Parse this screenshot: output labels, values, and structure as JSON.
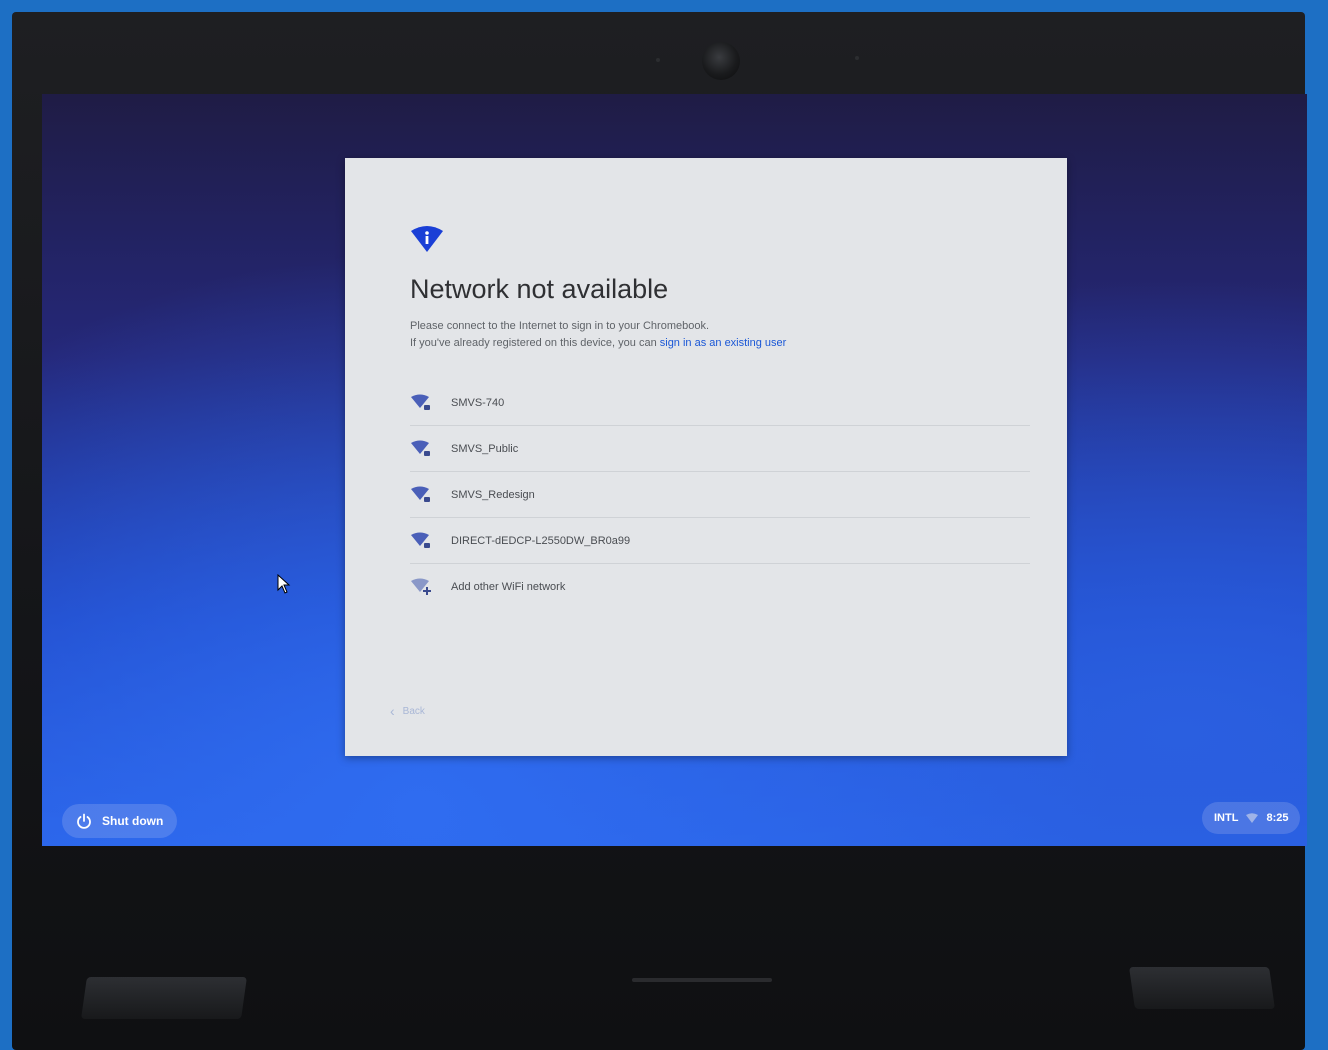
{
  "dialog": {
    "icon": "wifi-info-icon",
    "title": "Network not available",
    "line1": "Please connect to the Internet to sign in to your Chromebook.",
    "line2_prefix": "If you've already registered on this device, you can",
    "line2_link": "sign in as an existing user",
    "networks": [
      {
        "name": "SMVS-740",
        "icon": "wifi-secure-icon"
      },
      {
        "name": "SMVS_Public",
        "icon": "wifi-secure-icon"
      },
      {
        "name": "SMVS_Redesign",
        "icon": "wifi-secure-icon"
      },
      {
        "name": "DIRECT-dEDCP-L2550DW_BR0a99",
        "icon": "wifi-secure-icon"
      },
      {
        "name": "Add other WiFi network",
        "icon": "wifi-add-icon"
      }
    ],
    "back_label": "Back"
  },
  "shelf": {
    "shutdown_label": "Shut down",
    "input_method": "INTL",
    "time": "8:25"
  },
  "colors": {
    "accent": "#1a57d6",
    "dialog_bg": "#e3e5e8",
    "wallpaper_top": "#1f1c45",
    "wallpaper_bottom": "#2a63e8"
  }
}
